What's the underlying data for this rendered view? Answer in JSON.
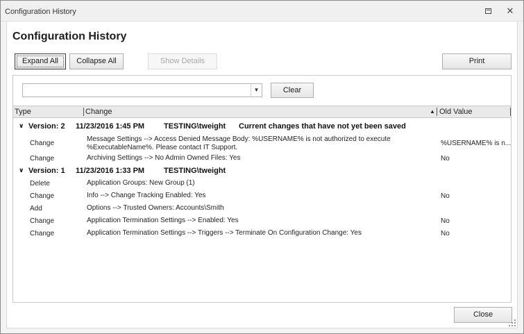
{
  "window": {
    "title": "Configuration History"
  },
  "heading": "Configuration History",
  "toolbar": {
    "expand_all": "Expand All",
    "collapse_all": "Collapse All",
    "show_details": "Show Details",
    "print": "Print"
  },
  "filter": {
    "value": "",
    "clear": "Clear"
  },
  "columns": {
    "type": "Type",
    "change": "Change",
    "old_value": "Old Value"
  },
  "groups": [
    {
      "version": "Version: 2",
      "date": "11/23/2016 1:45 PM",
      "user": "TESTING\\tweight",
      "note": "Current changes that have not yet been saved",
      "rows": [
        {
          "type": "Change",
          "change": "Message Settings --> Access Denied Message Body: %USERNAME% is not authorized to execute %ExecutableName%. Please contact IT Support.",
          "old": "%USERNAME% is n..."
        },
        {
          "type": "Change",
          "change": "Archiving Settings --> No Admin Owned Files: Yes",
          "old": "No"
        }
      ]
    },
    {
      "version": "Version: 1",
      "date": "11/23/2016 1:33 PM",
      "user": "TESTING\\tweight",
      "note": "",
      "rows": [
        {
          "type": "Delete",
          "change": "Application Groups: New Group (1)",
          "old": ""
        },
        {
          "type": "Change",
          "change": "Info --> Change Tracking Enabled: Yes",
          "old": "No"
        },
        {
          "type": "Add",
          "change": "Options --> Trusted Owners: Accounts\\Smith",
          "old": ""
        },
        {
          "type": "Change",
          "change": "Application Termination Settings --> Enabled: Yes",
          "old": "No"
        },
        {
          "type": "Change",
          "change": "Application Termination Settings --> Triggers --> Terminate On Configuration Change: Yes",
          "old": "No"
        }
      ]
    }
  ],
  "footer": {
    "close": "Close"
  },
  "icons": {
    "restore": "restore-window-icon",
    "close": "close-window-icon",
    "expander": "chevron-down-icon",
    "sort": "sort-ascending-icon",
    "dropdown": "dropdown-arrow-icon"
  }
}
